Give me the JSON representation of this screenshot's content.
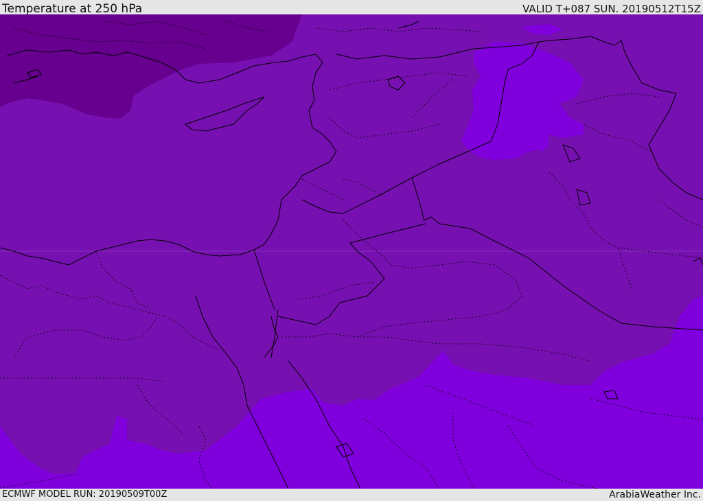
{
  "header": {
    "title": "Temperature at 250 hPa",
    "valid": "VALID T+087 SUN. 20190512T15Z"
  },
  "footer": {
    "model_run": "ECMWF MODEL RUN: 20190509T00Z",
    "credit": "ArabiaWeather Inc."
  },
  "map": {
    "colors": {
      "cold": "#67008f",
      "mid": "#7710b0",
      "warm": "#8000dd",
      "border": "#000000",
      "sea_line": "#9a40c0"
    }
  }
}
